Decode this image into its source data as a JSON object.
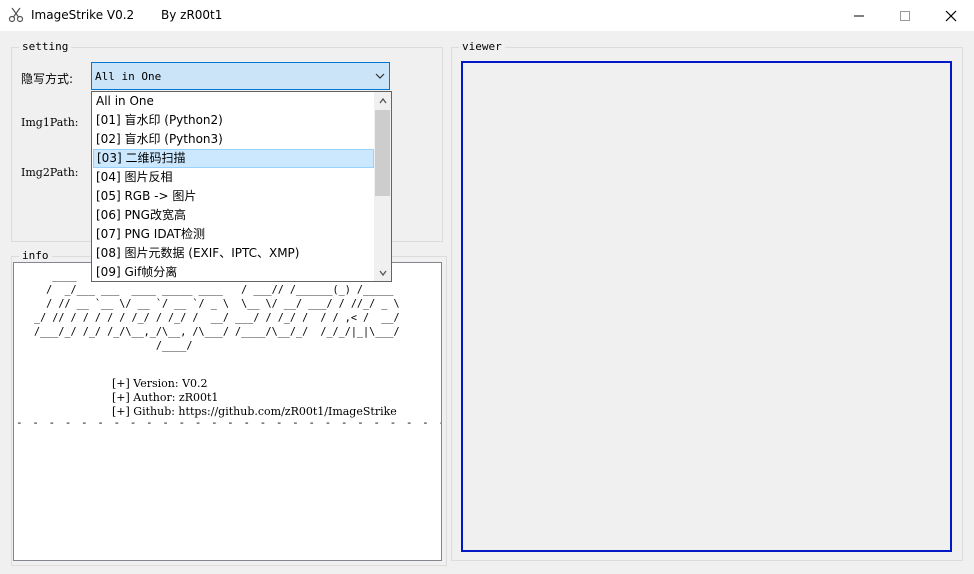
{
  "window": {
    "title": "ImageStrike V0.2",
    "author": "By zR00t1",
    "icons": {
      "app": "scissors-icon",
      "minimize": "minimize-icon",
      "maximize": "maximize-icon",
      "close": "close-icon"
    }
  },
  "setting": {
    "legend": "setting",
    "method_label": "隐写方式:",
    "img1_label": "Img1Path:",
    "img2_label": "Img2Path:",
    "method_value": "All in One",
    "dropdown_items": [
      "All in One",
      "[01] 盲水印 (Python2)",
      "[02] 盲水印 (Python3)",
      "[03] 二维码扫描",
      "[04] 图片反相",
      "[05] RGB -> 图片",
      "[06] PNG改宽高",
      "[07] PNG IDAT检测",
      "[08] 图片元数据 (EXIF、IPTC、XMP)",
      "[09] Gif帧分离"
    ],
    "highlighted_item": "[03] 二维码扫描"
  },
  "info": {
    "legend": "info",
    "version_line": "[+] Version: V0.2",
    "author_line": "[+] Author: zR00t1",
    "github_line": "[+] Github: https://github.com/zR00t1/ImageStrike",
    "separator": "- - - - - - - - - - - - - - - - - - - - - - - - - - - - - - - - - - - - - - - -"
  },
  "viewer": {
    "legend": "viewer",
    "border_color": "#0018c8"
  }
}
